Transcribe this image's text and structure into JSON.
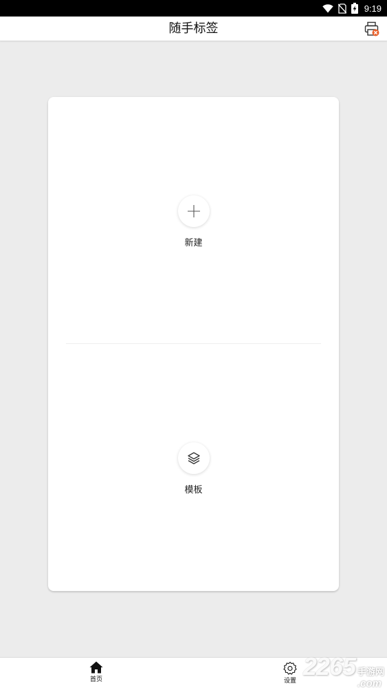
{
  "status_bar": {
    "time": "9:19",
    "icons": [
      "wifi-icon",
      "no-sim-icon",
      "battery-charging-icon"
    ]
  },
  "header": {
    "title": "随手标签",
    "action_icon": "printer-icon"
  },
  "card": {
    "new": {
      "label": "新建",
      "icon": "plus-icon"
    },
    "template": {
      "label": "模板",
      "icon": "layers-icon"
    }
  },
  "bottom_nav": {
    "items": [
      {
        "label": "首页",
        "icon": "home-icon",
        "active": true
      },
      {
        "label": "设置",
        "icon": "gear-icon",
        "active": false
      }
    ]
  },
  "watermark": {
    "number": "2265",
    "cn": "手游网",
    "suffix": ".com"
  },
  "colors": {
    "background": "#ececec",
    "surface": "#ffffff",
    "printer_accent": "#e8612c"
  }
}
